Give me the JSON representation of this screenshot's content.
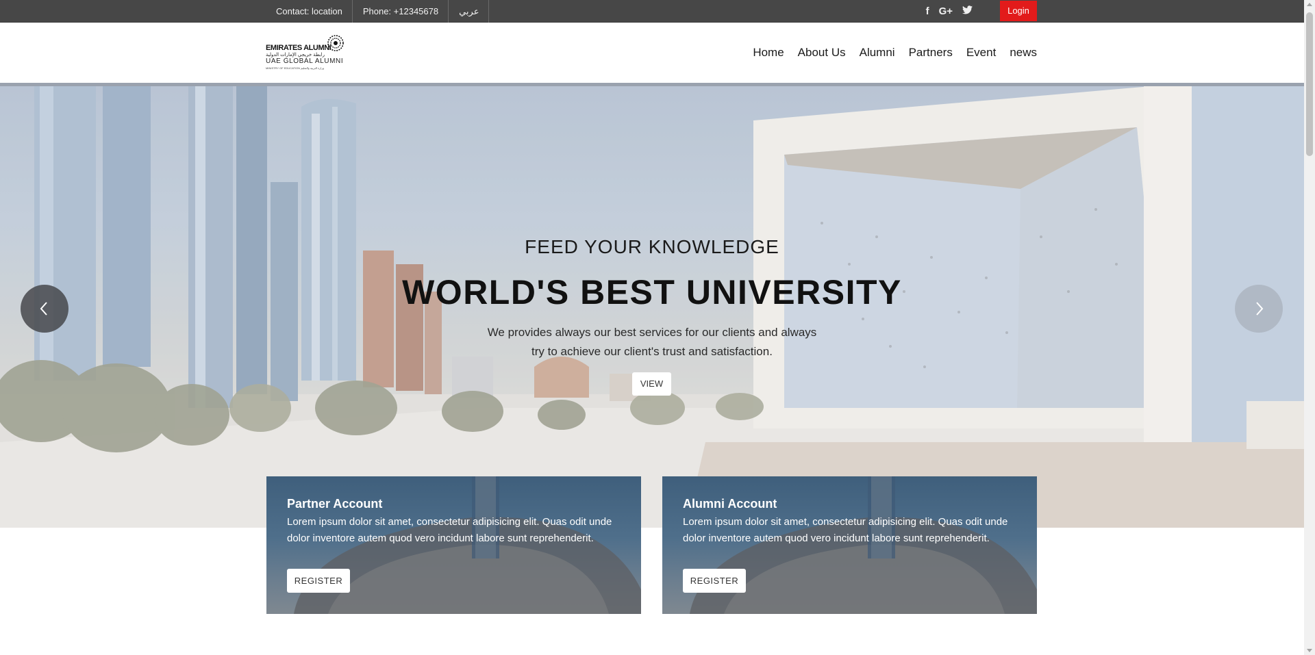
{
  "topbar": {
    "contact": "Contact: location",
    "phone": "Phone: +12345678",
    "language": "عربي",
    "social": [
      {
        "icon": "facebook-icon",
        "glyph": "f"
      },
      {
        "icon": "google-plus-icon",
        "glyph": "G+"
      },
      {
        "icon": "twitter-icon",
        "glyph": "t"
      }
    ],
    "login_label": "Login",
    "login_color": "#e21b1b"
  },
  "logo": {
    "line1": "EMIRATES ALUMNI",
    "line2": "رابطة خريجي الإمارات الدولية",
    "line3": "UAE GLOBAL ALUMNI",
    "line4": "MINISTRY OF EDUCATION وزارة التربية والتعليم"
  },
  "nav": {
    "items": [
      "Home",
      "About Us",
      "Alumni",
      "Partners",
      "Event",
      "news"
    ]
  },
  "hero": {
    "kicker": "FEED YOUR KNOWLEDGE",
    "headline": "WORLD'S BEST UNIVERSITY",
    "sub_line1": "We provides always our best services for our clients and always",
    "sub_line2": "try to achieve our client's trust and satisfaction.",
    "view_label": "VIEW",
    "prev_icon": "chevron-left-icon",
    "next_icon": "chevron-right-icon"
  },
  "cards": [
    {
      "title": "Partner Account",
      "body": "Lorem ipsum dolor sit amet, consectetur adipisicing elit. Quas odit unde dolor inventore autem quod vero incidunt labore sunt reprehenderit.",
      "button": "REGISTER"
    },
    {
      "title": "Alumni Account",
      "body": "Lorem ipsum dolor sit amet, consectetur adipisicing elit. Quas odit unde dolor inventore autem quod vero incidunt labore sunt reprehenderit.",
      "button": "REGISTER"
    }
  ]
}
